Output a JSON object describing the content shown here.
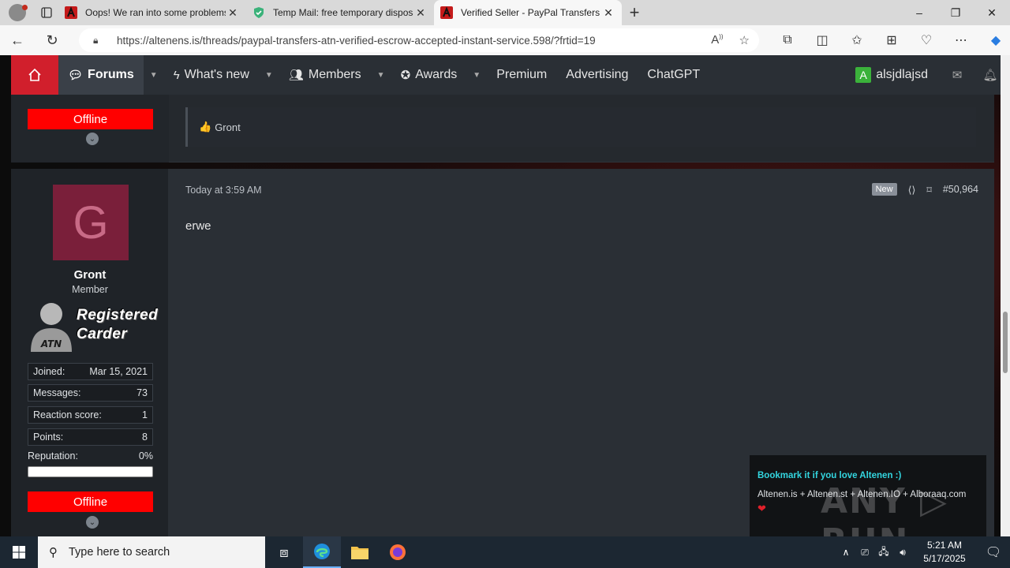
{
  "browser": {
    "tabs": [
      {
        "title": "Oops! We ran into some problems",
        "active": false
      },
      {
        "title": "Temp Mail: free temporary disposable email",
        "active": false
      },
      {
        "title": "Verified Seller - PayPal Transfers - ATN",
        "active": true
      }
    ],
    "url": "https://altenens.is/threads/paypal-transfers-atn-verified-escrow-accepted-instant-service.598/?frtid=19",
    "window_controls": {
      "minimize": "–",
      "restore": "❐",
      "close": "✕"
    }
  },
  "forum_nav": {
    "items": [
      {
        "label": "Forums",
        "icon": "chat-icon",
        "has_caret": true,
        "selected": true
      },
      {
        "label": "What's new",
        "icon": "lightning-icon",
        "has_caret": true
      },
      {
        "label": "Members",
        "icon": "people-icon",
        "has_caret": true
      },
      {
        "label": "Awards",
        "icon": "award-icon",
        "has_caret": true
      },
      {
        "label": "Premium"
      },
      {
        "label": "Advertising"
      },
      {
        "label": "ChatGPT"
      }
    ],
    "user": {
      "initial": "A",
      "name": "alsjdlajsd"
    }
  },
  "prev_post": {
    "status": "Offline",
    "reaction_user": "Gront"
  },
  "post": {
    "author": {
      "initial": "G",
      "name": "Gront",
      "role": "Member",
      "banner_line1": "Registered",
      "banner_line2": "Carder",
      "banner_badge": "ATN",
      "stats": [
        {
          "label": "Joined:",
          "value": "Mar 15, 2021"
        },
        {
          "label": "Messages:",
          "value": "73"
        },
        {
          "label": "Reaction score:",
          "value": "1"
        },
        {
          "label": "Points:",
          "value": "8"
        }
      ],
      "reputation_label": "Reputation:",
      "reputation_value": "0%",
      "status": "Offline"
    },
    "date": "Today at 3:59 AM",
    "badge": "New",
    "number": "#50,964",
    "body": "erwe"
  },
  "toast": {
    "heading": "Bookmark it if you love Altenen :)",
    "line": "Altenen.is + Altenen.st + Altenen.IO + Alboraaq.com",
    "heart": "❤"
  },
  "watermark": "ANY ▷ RUN",
  "taskbar": {
    "search_placeholder": "Type here to search",
    "time": "5:21 AM",
    "date": "5/17/2025"
  }
}
